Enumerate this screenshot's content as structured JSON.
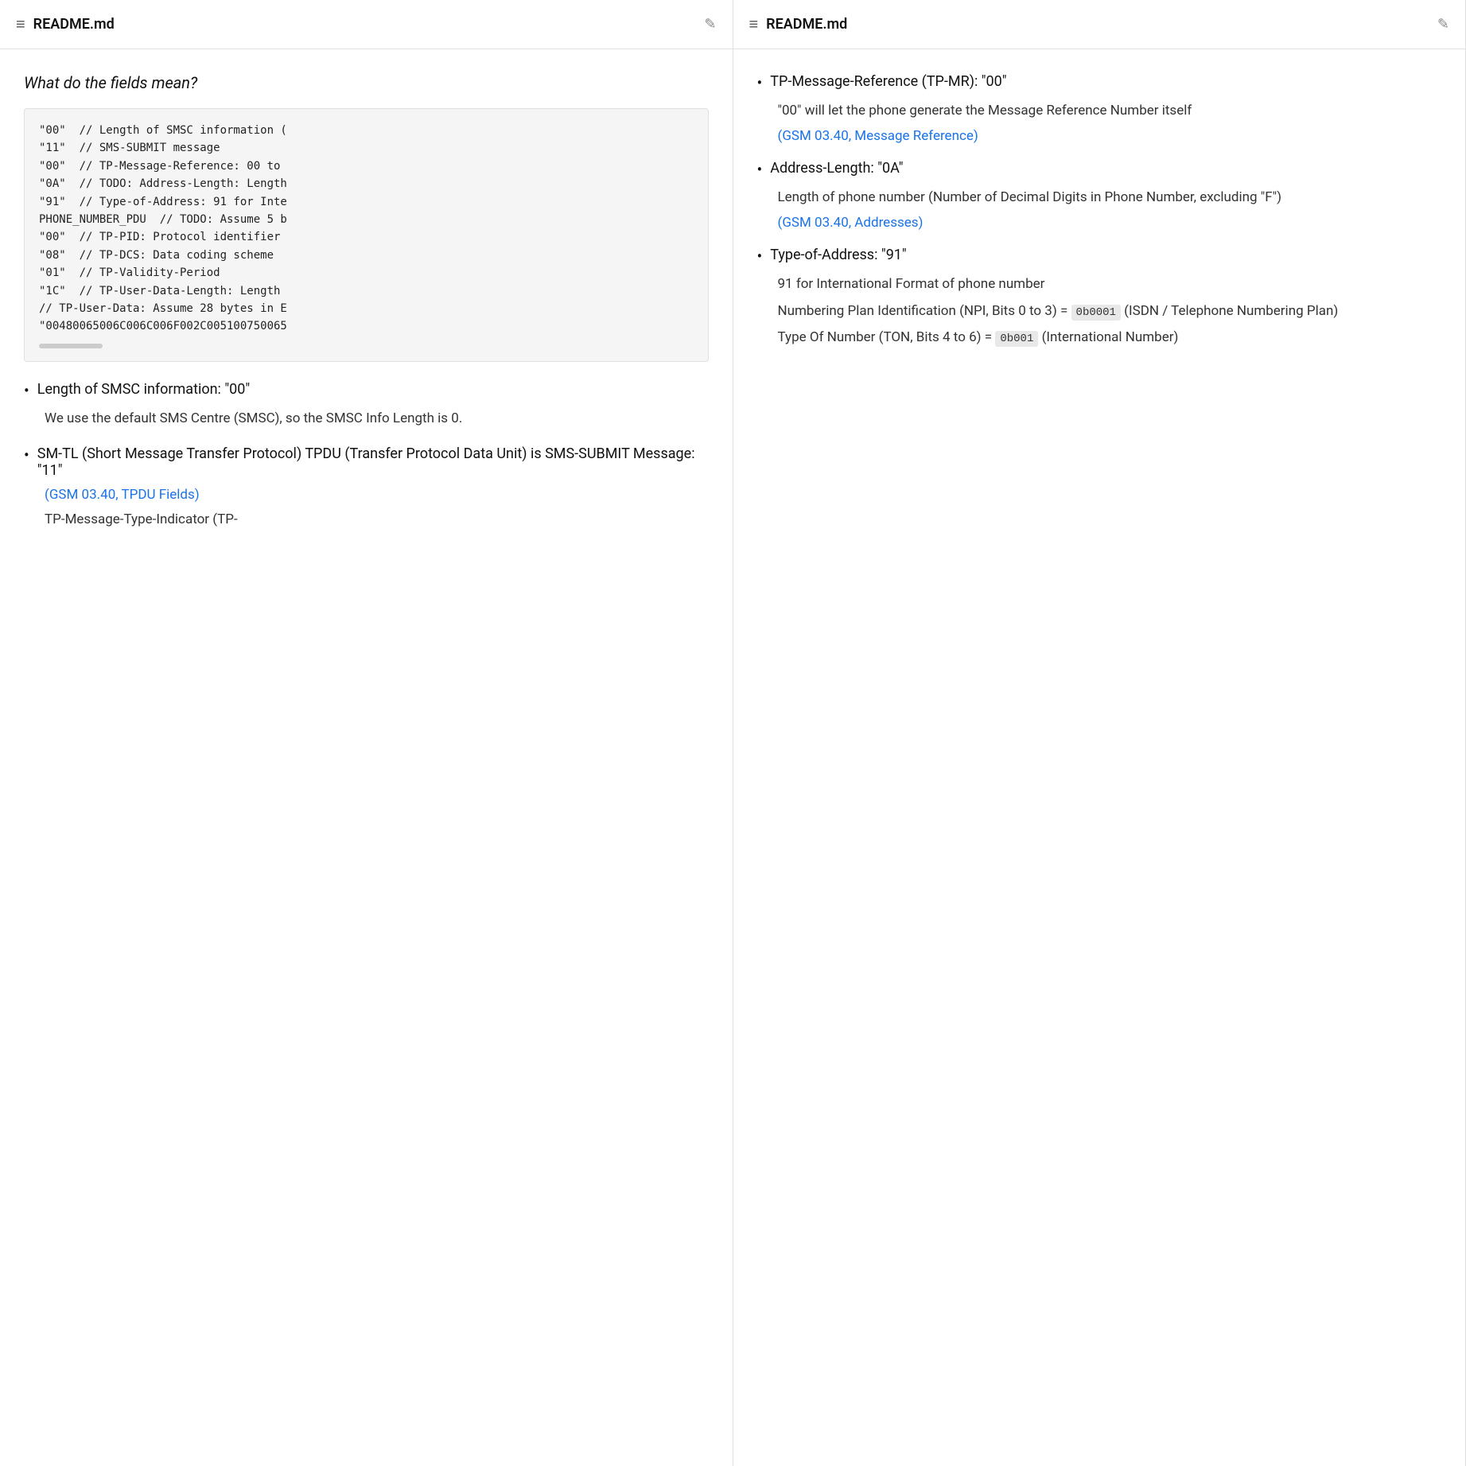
{
  "left_panel": {
    "header": {
      "menu_icon": "≡",
      "title": "README.md",
      "edit_icon": "✎"
    },
    "section_heading": "What do the fields mean?",
    "code_block": {
      "lines": [
        "\"00\"  // Length of SMSC information (",
        "\"11\"  // SMS-SUBMIT message",
        "\"00\"  // TP-Message-Reference: 00 to",
        "\"0A\"  // TODO: Address-Length: Length",
        "\"91\"  // Type-of-Address: 91 for Inte",
        "PHONE_NUMBER_PDU  // TODO: Assume 5 b",
        "\"00\"  // TP-PID: Protocol identifier",
        "\"08\"  // TP-DCS: Data coding scheme",
        "\"01\"  // TP-Validity-Period",
        "\"1C\"  // TP-User-Data-Length: Length",
        "// TP-User-Data: Assume 28 bytes in E",
        "\"00480065006C006C006F002C00510075006"
      ]
    },
    "bullets": [
      {
        "header": "Length of SMSC information: \"00\"",
        "body": "We use the default SMS Centre (SMSC), so the SMSC Info Length is 0.",
        "link": null
      },
      {
        "header": "SM-TL (Short Message Transfer Protocol) TPDU (Transfer Protocol Data Unit) is SMS-SUBMIT Message: \"11\"",
        "body": null,
        "link": "(GSM 03.40, TPDU Fields)"
      },
      {
        "header": "TP-Message-Type-Indicator (TP-",
        "body": null,
        "link": null
      }
    ]
  },
  "right_panel": {
    "header": {
      "menu_icon": "≡",
      "title": "README.md",
      "edit_icon": "✎"
    },
    "bullets": [
      {
        "header": "TP-Message-Reference (TP-MR): \"00\"",
        "body": "\"00\" will let the phone generate the Message Reference Number itself",
        "link": "(GSM 03.40, Message Reference)"
      },
      {
        "header": "Address-Length: \"0A\"",
        "body": "Length of phone number (Number of Decimal Digits in Phone Number, excluding \"F\")",
        "link": "(GSM 03.40, Addresses)"
      },
      {
        "header": "Type-of-Address: \"91\"",
        "body_parts": [
          "91 for International Format of phone number",
          "Numbering Plan Identification (NPI, Bits 0 to 3) = {NPI_CODE} (ISDN / Telephone Numbering Plan)",
          "Type Of Number (TON, Bits 4 to 6) = {TON_CODE} (International Number)"
        ],
        "npi_code": "0b0001",
        "ton_code": "0b001",
        "link": null
      }
    ]
  }
}
